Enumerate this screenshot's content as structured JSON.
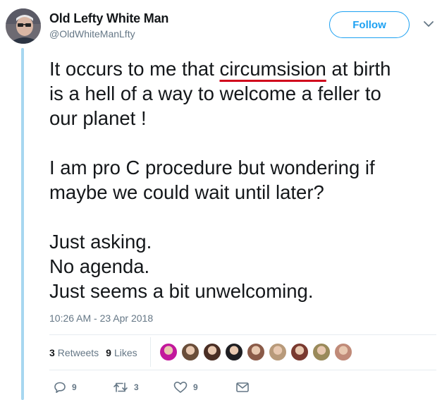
{
  "tweet": {
    "author_name": "Old Lefty White Man",
    "author_handle": "@OldWhiteManLfty",
    "follow_label": "Follow",
    "paragraphs": [
      {
        "lines": [
          {
            "pre": "It occurs to me that ",
            "flagged": "circumsision",
            "post": " at birth"
          },
          {
            "text": "is a hell of a way to welcome a feller to"
          },
          {
            "text": "our planet !"
          }
        ]
      },
      {
        "lines": [
          {
            "text": "I am pro C procedure but wondering if"
          },
          {
            "text": "maybe we could wait until later?"
          }
        ]
      },
      {
        "lines": [
          {
            "text": "Just asking."
          },
          {
            "text": "No agenda."
          },
          {
            "text": "Just seems a bit unwelcoming."
          }
        ]
      }
    ],
    "timestamp": "10:26 AM - 23 Apr 2018",
    "stats": {
      "retweets_count": "3",
      "retweets_label": "Retweets",
      "likes_count": "9",
      "likes_label": "Likes"
    },
    "liker_avatar_colors": [
      "#c2189c",
      "#6a4e3a",
      "#4a2e24",
      "#1e1e22",
      "#8a5a48",
      "#b89a7a",
      "#7a3a30",
      "#9a8a5a",
      "#c08a78"
    ],
    "actions": {
      "reply_count": "9",
      "retweet_count": "3",
      "like_count": "9"
    }
  },
  "colors": {
    "accent": "#1da1f2",
    "thread_line": "#a7d7f0",
    "muted": "#657786",
    "spellcheck_underline": "#d0021b"
  }
}
